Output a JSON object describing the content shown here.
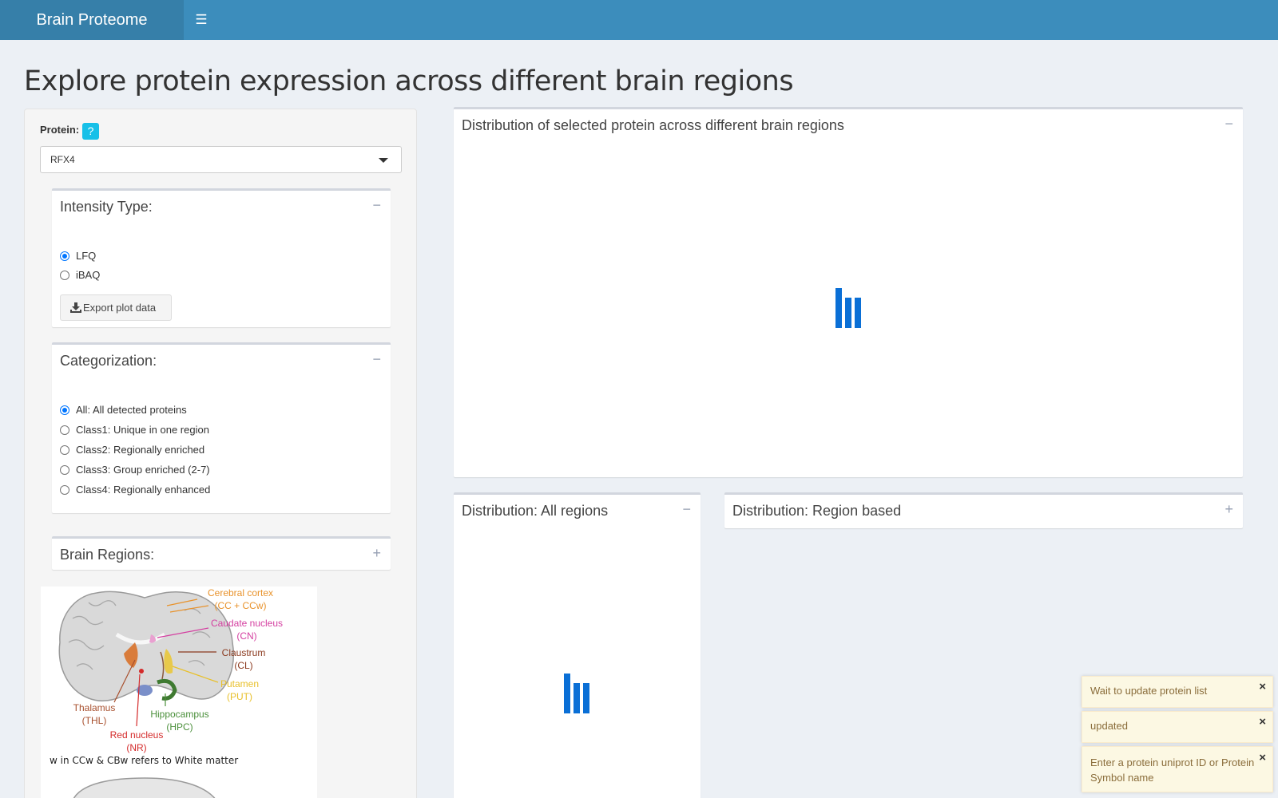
{
  "header": {
    "brand": "Brain Proteome",
    "menu_icon": "☰"
  },
  "page_title": "Explore protein expression across different brain regions",
  "sidebar": {
    "protein_label": "Protein:",
    "help_icon": "?",
    "protein_value": "RFX4",
    "intensity": {
      "title": "Intensity Type:",
      "collapse": "−",
      "options": [
        "LFQ",
        "iBAQ"
      ],
      "selected": "LFQ",
      "export_label": "Export plot data"
    },
    "categorization": {
      "title": "Categorization:",
      "collapse": "−",
      "options": [
        "All: All detected proteins",
        "Class1: Unique in one region",
        "Class2: Regionally enriched",
        "Class3: Group enriched (2-7)",
        "Class4: Regionally enhanced"
      ],
      "selected": "All: All detected proteins"
    },
    "brain_regions": {
      "title": "Brain Regions:",
      "expand": "+"
    }
  },
  "brain_figure": {
    "cerebral_cortex": "Cerebral cortex",
    "cerebral_cortex_abbr": "(CC + CCw)",
    "caudate": "Caudate nucleus",
    "caudate_abbr": "(CN)",
    "claustrum": "Claustrum",
    "claustrum_abbr": "(CL)",
    "putamen": "Putamen",
    "putamen_abbr": "(PUT)",
    "thalamus": "Thalamus",
    "thalamus_abbr": "(THL)",
    "hippocampus": "Hippocampus",
    "hippocampus_abbr": "(HPC)",
    "red_nucleus": "Red nucleus",
    "red_nucleus_abbr": "(NR)",
    "note": "w in CCw & CBw refers to White matter"
  },
  "main": {
    "dist_box": {
      "title": "Distribution of selected protein across different brain regions",
      "collapse": "−"
    },
    "all_regions": {
      "title": "Distribution: All regions",
      "collapse": "−"
    },
    "region_based": {
      "title": "Distribution: Region based",
      "expand": "+"
    }
  },
  "notifications": [
    {
      "text": "Wait to update protein list",
      "close": "×"
    },
    {
      "text": "updated",
      "close": "×"
    },
    {
      "text": "Enter a protein uniprot ID or Protein Symbol name",
      "close": "×"
    }
  ],
  "colors": {
    "header": "#3c8dbc",
    "brand_bg": "#367fa9",
    "accent": "#0a6fd6",
    "help": "#17c0e8",
    "notif_bg": "#fcf8e3",
    "cortex": "#e8922b",
    "caudate": "#d43fa0",
    "claustrum": "#8b3a1f",
    "putamen": "#e8c02b",
    "thalamus": "#a8502e",
    "hippocampus": "#4a8f3a",
    "red_nucleus": "#d42a2a"
  }
}
